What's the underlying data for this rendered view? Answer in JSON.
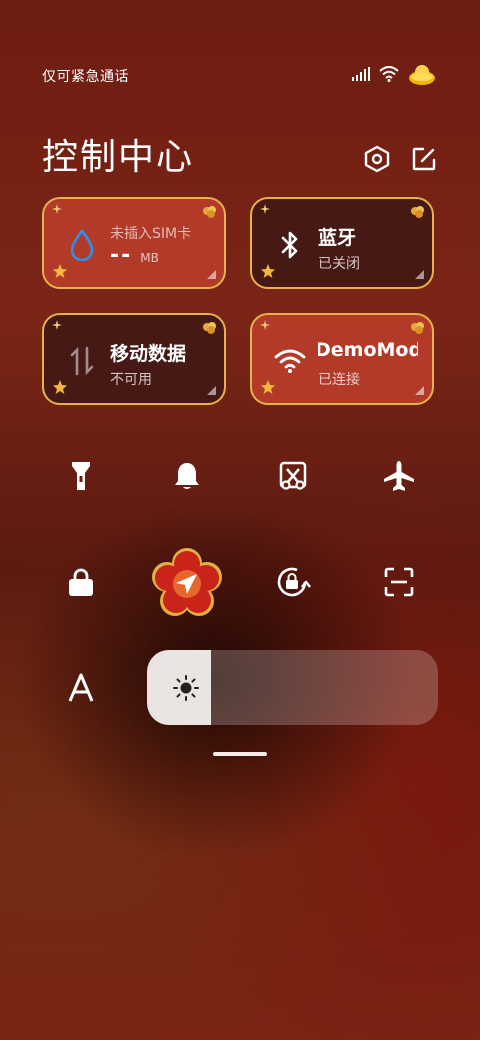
{
  "status_bar": {
    "carrier_text": "仅可紧急通话"
  },
  "header": {
    "title": "控制中心"
  },
  "tiles": [
    {
      "title": "未插入SIM卡",
      "value": "--",
      "unit": "MB",
      "state": "active"
    },
    {
      "title": "蓝牙",
      "subtitle": "已关闭",
      "state": "inactive"
    },
    {
      "title": "移动数据",
      "subtitle": "不可用",
      "state": "inactive"
    },
    {
      "title": "DemoMod",
      "subtitle": "已连接",
      "state": "active"
    }
  ],
  "quick_buttons": [
    "flashlight-icon",
    "bell-icon",
    "screen-cast-icon",
    "airplane-icon",
    "lock-icon",
    "location-icon",
    "rotation-lock-icon",
    "scan-icon"
  ],
  "brightness": {
    "level": 0.22
  },
  "colors": {
    "accent_border": "#e7b24a",
    "tile_active": "#b93e2c",
    "tile_inactive": "#3e1814",
    "drop_blue": "#2f8ff0"
  }
}
